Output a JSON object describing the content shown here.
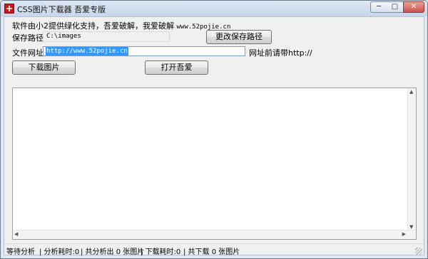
{
  "window": {
    "title": "CSS图片下载器 吾爱专版",
    "controls": {
      "minimize": "─",
      "maximize": "□",
      "close": "✕"
    }
  },
  "info": {
    "support_text": "软件由小2提供绿化支持，吾爱破解，我爱破解 ",
    "site": "www.52pojie.cn"
  },
  "save_path": {
    "label": "保存路径:",
    "value": "C:\\images",
    "change_button": "更改保存路径"
  },
  "url": {
    "label": "文件网址:",
    "value": "http://www.52pojie.cn",
    "hint": "网址前请带http://"
  },
  "actions": {
    "download_button": "下载图片",
    "open_button": "打开吾爱"
  },
  "status": {
    "state": "等待分析",
    "analysis_time": "| 分析耗时:0",
    "analysis_count": "| 共分析出 0 张图片",
    "download_time": "| 下载耗时:0",
    "download_count": "| 共下载 0 张图片"
  }
}
